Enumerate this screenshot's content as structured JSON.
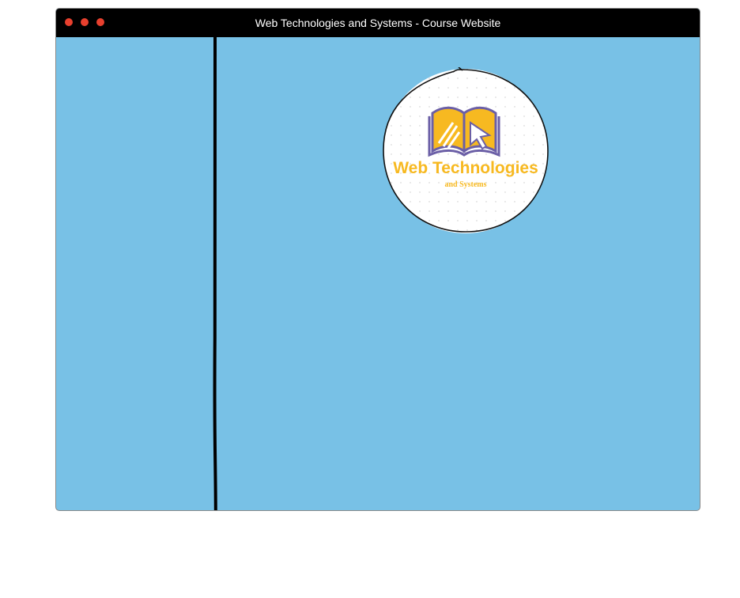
{
  "window": {
    "title": "Web Technologies and Systems - Course Website",
    "colors": {
      "titlebar": "#000000",
      "background": "#78c1e6",
      "dot": "#e8402e"
    }
  },
  "logo": {
    "title": "Web Technologies",
    "subtitle": "and Systems",
    "icon": "open-book-with-cursor-icon",
    "colors": {
      "book_fill": "#f7b921",
      "book_outline": "#6b5fa6",
      "text": "#f7b921",
      "circle_fill": "#ffffff"
    }
  }
}
